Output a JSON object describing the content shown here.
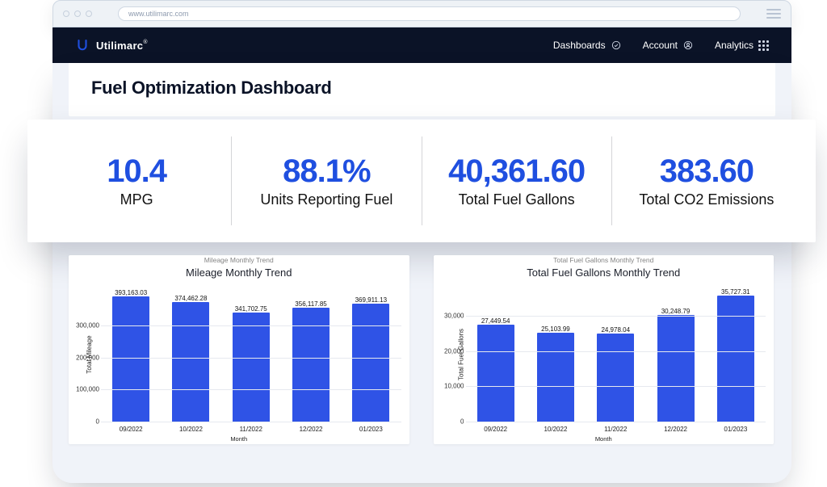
{
  "browser": {
    "url": "www.utilimarc.com"
  },
  "brand": {
    "name": "Utilimarc",
    "tm": "®"
  },
  "nav": {
    "dashboards": "Dashboards",
    "account": "Account",
    "analytics": "Analytics"
  },
  "page": {
    "title": "Fuel Optimization Dashboard"
  },
  "peek": {
    "left": "Mileage Monthly Trend",
    "right": "Total Fuel Gallons Monthly Trend"
  },
  "kpis": [
    {
      "value": "10.4",
      "label": "MPG"
    },
    {
      "value": "88.1%",
      "label": "Units Reporting Fuel"
    },
    {
      "value": "40,361.60",
      "label": "Total Fuel Gallons"
    },
    {
      "value": "383.60",
      "label": "Total CO2 Emissions"
    }
  ],
  "charts": {
    "mileage": {
      "title_clip": "Mileage Monthly Trend",
      "title": "Mileage Monthly Trend",
      "ylabel": "Total Mileage",
      "xcaption": "Month"
    },
    "fuel": {
      "title_clip": "Total Fuel Gallons Monthly Trend",
      "title": "Total Fuel Gallons Monthly Trend",
      "ylabel": "Total Fuel Gallons",
      "xcaption": "Month"
    }
  },
  "chart_data": [
    {
      "id": "mileage",
      "type": "bar",
      "title": "Mileage Monthly Trend",
      "xlabel": "Month",
      "ylabel": "Total Mileage",
      "categories": [
        "09/2022",
        "10/2022",
        "11/2022",
        "12/2022",
        "01/2023"
      ],
      "values": [
        393163.03,
        374462.28,
        341702.75,
        356117.85,
        369911.13
      ],
      "value_labels": [
        "393,163.03",
        "374,462.28",
        "341,702.75",
        "356,117.85",
        "369,911.13"
      ],
      "yticks": [
        0,
        100000,
        200000,
        300000
      ],
      "ytick_labels": [
        "0",
        "100,000",
        "200,000",
        "300,000"
      ],
      "ylim": [
        0,
        420000
      ]
    },
    {
      "id": "fuel",
      "type": "bar",
      "title": "Total Fuel Gallons Monthly Trend",
      "xlabel": "Month",
      "ylabel": "Total Fuel Gallons",
      "categories": [
        "09/2022",
        "10/2022",
        "11/2022",
        "12/2022",
        "01/2023"
      ],
      "values": [
        27449.54,
        25103.99,
        24978.04,
        30248.79,
        35727.31
      ],
      "value_labels": [
        "27,449.54",
        "25,103.99",
        "24,978.04",
        "30,248.79",
        "35,727.31"
      ],
      "yticks": [
        0,
        10000,
        20000,
        30000
      ],
      "ytick_labels": [
        "0",
        "10,000",
        "20,000",
        "30,000"
      ],
      "ylim": [
        0,
        38000
      ]
    }
  ]
}
